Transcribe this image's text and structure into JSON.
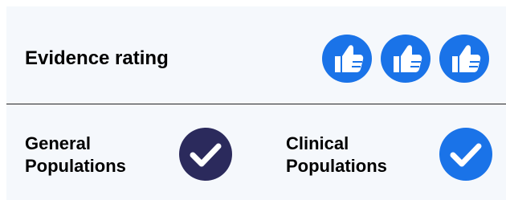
{
  "evidence": {
    "title": "Evidence rating",
    "rating": 3,
    "rating_max": 3,
    "icon": "thumbs-up-icon",
    "icon_color": "#1a73e8"
  },
  "populations": [
    {
      "line1": "General",
      "line2": "Populations",
      "status_icon": "check-circle-icon",
      "color": "#2b2a5c"
    },
    {
      "line1": "Clinical",
      "line2": "Populations",
      "status_icon": "check-circle-icon",
      "color": "#1a73e8"
    }
  ]
}
